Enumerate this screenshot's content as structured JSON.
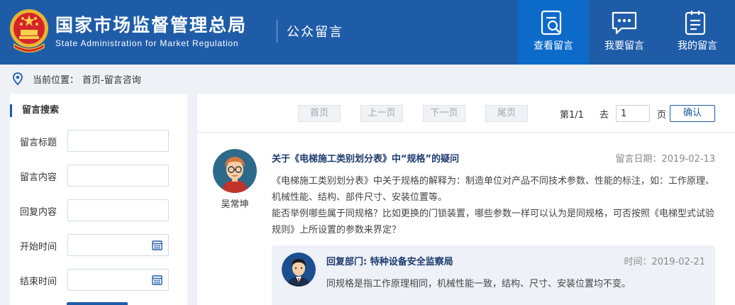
{
  "header": {
    "title_cn": "国家市场监督管理总局",
    "title_en": "State Administration for Market Regulation",
    "section": "公众留言",
    "nav": [
      {
        "label": "查看留言",
        "icon": "document-search-icon"
      },
      {
        "label": "我要留言",
        "icon": "chat-bubble-icon"
      },
      {
        "label": "我的留言",
        "icon": "clipboard-list-icon"
      }
    ],
    "brand_color": "#1f5ca8",
    "active_nav_color": "#0c6ac9"
  },
  "breadcrumb": {
    "label": "当前位置：",
    "path": "首页-留言咨询"
  },
  "sidebar": {
    "title": "留言搜索",
    "fields": [
      {
        "label": "留言标题",
        "value": ""
      },
      {
        "label": "留言内容",
        "value": ""
      },
      {
        "label": "回复内容",
        "value": ""
      },
      {
        "label": "开始时间",
        "value": ""
      },
      {
        "label": "结束时间",
        "value": ""
      }
    ]
  },
  "pager": {
    "first": "首页",
    "prev": "上一页",
    "next": "下一页",
    "last": "尾页",
    "page_info": "第1/1",
    "goto_label": "去",
    "page_value": "1",
    "page_unit": "页",
    "confirm": "确认"
  },
  "message": {
    "author": "吴常坤",
    "title": "关于《电梯施工类别划分表》中“规格”的疑问",
    "date": "留言日期：2019-02-13",
    "body": "《电梯施工类别划分表》中关于规格的解释为：制造单位对产品不同技术参数、性能的标注，如：工作原理、机械性能、结构、部件尺寸、安装位置等。\n能否举例哪些属于同规格？比如更换的门锁装置，哪些参数一样可以认为是同规格，可否按照《电梯型式试验规则》上所设置的参数来界定？",
    "reply": {
      "department": "回复部门: 特种设备安全监察局",
      "date": "时间：2019-02-21",
      "body": "同规格是指工作原理相同，机械性能一致，结构、尺寸、安装位置均不变。"
    }
  }
}
